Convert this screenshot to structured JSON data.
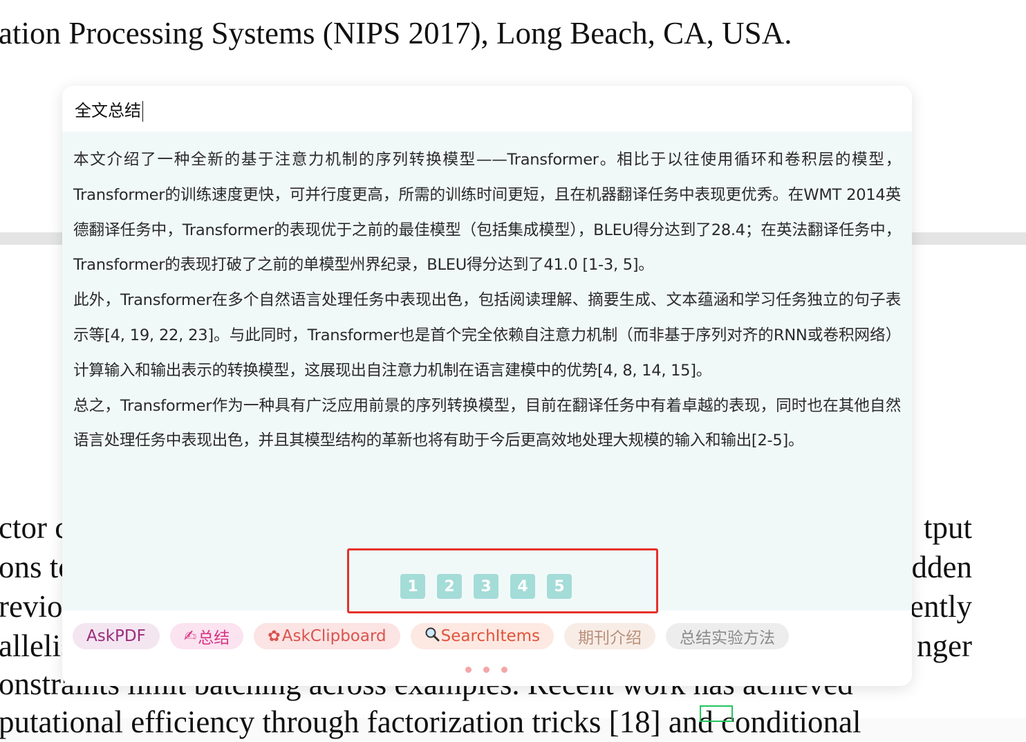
{
  "pdf": {
    "heading": "ation Processing Systems (NIPS 2017), Long Beach, CA, USA.",
    "body_left": [
      "ctor c",
      "ons to",
      "revio",
      "allelis",
      "onstraints limit batching across examples. Recent work has achieved",
      "putational efficiency through factorization tricks [18] and conditional"
    ],
    "body_right": [
      "tput",
      "dden",
      "ently",
      "nger"
    ]
  },
  "panel": {
    "query": "全文总结",
    "summary_paragraphs": [
      "本文介绍了一种全新的基于注意力机制的序列转换模型——Transformer。相比于以往使用循环和卷积层的模型，Transformer的训练速度更快，可并行度更高，所需的训练时间更短，且在机器翻译任务中表现更优秀。在WMT 2014英德翻译任务中，Transformer的表现优于之前的最佳模型（包括集成模型），BLEU得分达到了28.4；在英法翻译任务中，Transformer的表现打破了之前的单模型州界纪录，BLEU得分达到了41.0 [1-3, 5]。",
      "此外，Transformer在多个自然语言处理任务中表现出色，包括阅读理解、摘要生成、文本蕴涵和学习任务独立的句子表示等[4, 19, 22, 23]。与此同时，Transformer也是首个完全依赖自注意力机制（而非基于序列对齐的RNN或卷积网络）计算输入和输出表示的转换模型，这展现出自注意力机制在语言建模中的优势[4, 8, 14, 15]。",
      "总之，Transformer作为一种具有广泛应用前景的序列转换模型，目前在翻译任务中有着卓越的表现，同时也在其他自然语言处理任务中表现出色，并且其模型结构的革新也将有助于今后更高效地处理大规模的输入和输出[2-5]。"
    ],
    "references": [
      "1",
      "2",
      "3",
      "4",
      "5"
    ],
    "chips": [
      {
        "label": "AskPDF",
        "icon": "",
        "color": "#9b2c7a",
        "bg": "#f3e6f1"
      },
      {
        "label": "总结",
        "icon": "✍",
        "color": "#d63384",
        "bg": "#fbe3f0"
      },
      {
        "label": "AskClipboard",
        "icon": "✿",
        "color": "#d9534f",
        "bg": "#fbe4e3"
      },
      {
        "label": "SearchItems",
        "icon": "🔍",
        "color": "#e0553b",
        "bg": "#fde8e2"
      },
      {
        "label": "期刊介绍",
        "icon": "",
        "color": "#b8907a",
        "bg": "#f8ece6"
      },
      {
        "label": "总结实验方法",
        "icon": "",
        "color": "#8a8a8a",
        "bg": "#ededed"
      }
    ]
  }
}
